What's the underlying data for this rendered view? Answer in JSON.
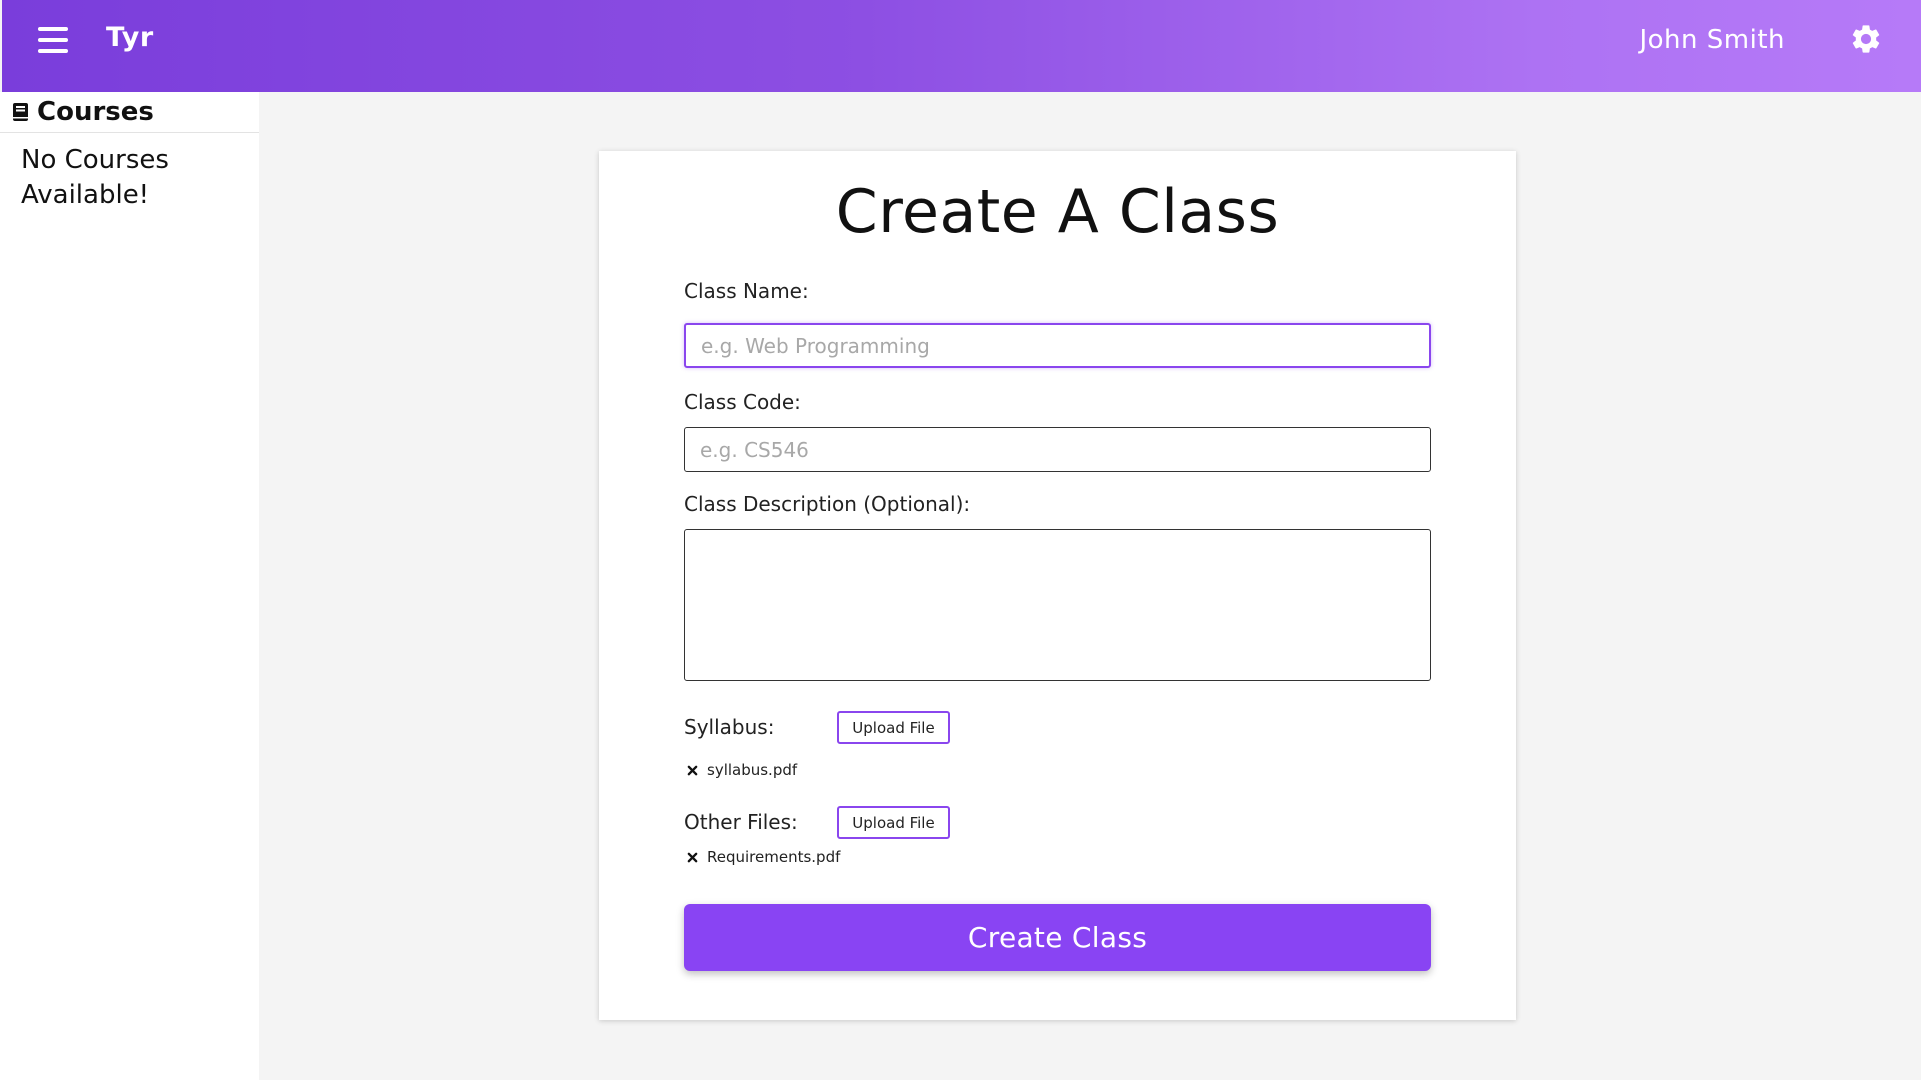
{
  "header": {
    "app_name": "Tyr",
    "user_name": "John Smith",
    "menu_icon": "hamburger-menu-icon",
    "settings_icon": "gear-icon",
    "gradient_start": "#7a3ddb",
    "gradient_end": "#b67af8"
  },
  "sidebar": {
    "title": "Courses",
    "title_icon": "book-icon",
    "empty_message": "No Courses Available!"
  },
  "form": {
    "title": "Create A Class",
    "class_name": {
      "label": "Class Name:",
      "placeholder": "e.g. Web Programming",
      "value": ""
    },
    "class_code": {
      "label": "Class Code:",
      "placeholder": "e.g. CS546",
      "value": ""
    },
    "class_description": {
      "label": "Class Description (Optional):",
      "value": ""
    },
    "syllabus": {
      "label": "Syllabus:",
      "upload_label": "Upload File",
      "files": [
        "syllabus.pdf"
      ]
    },
    "other_files": {
      "label": "Other Files:",
      "upload_label": "Upload File",
      "files": [
        "Requirements.pdf"
      ]
    },
    "submit_label": "Create Class"
  },
  "colors": {
    "accent": "#8944f3",
    "focus_border": "#8a46ee",
    "background": "#f4f4f4"
  }
}
